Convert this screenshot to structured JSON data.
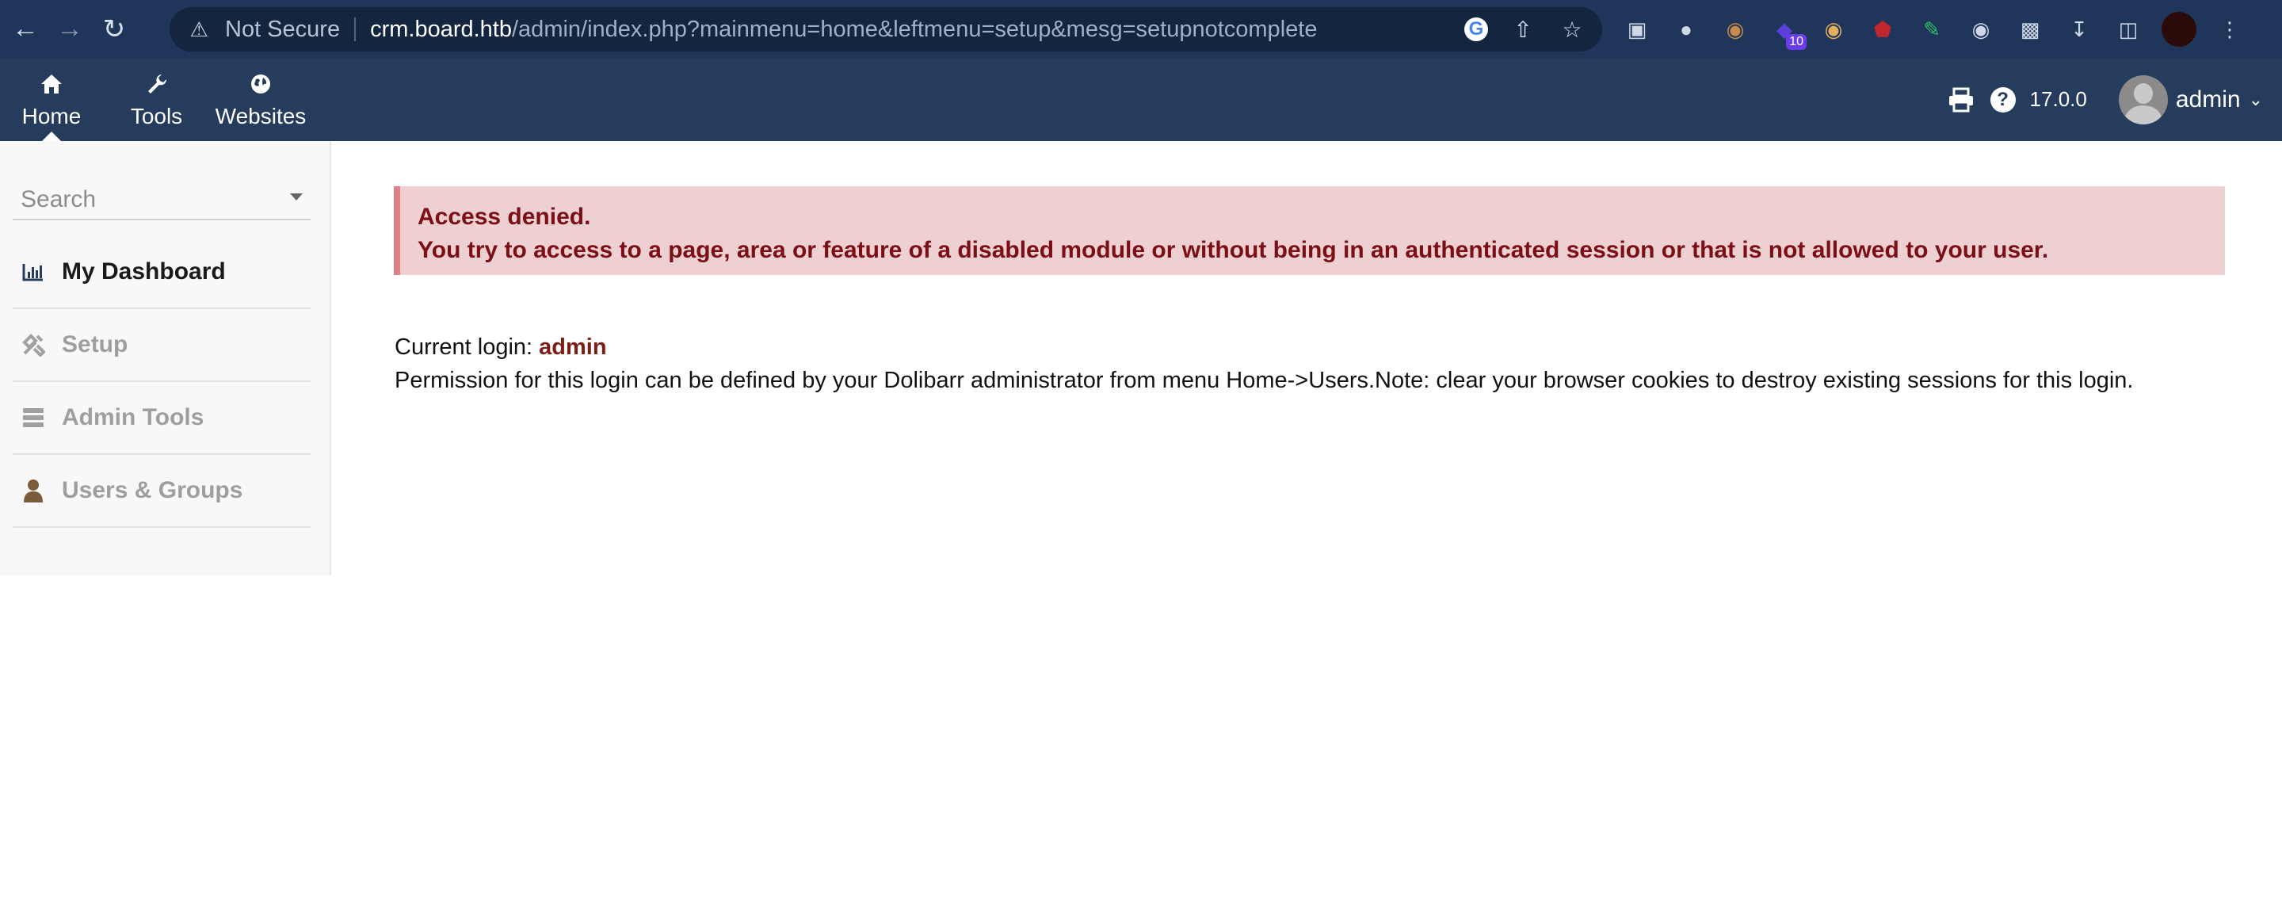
{
  "browser": {
    "security_label": "Not Secure",
    "url_host": "crm.board.htb",
    "url_path": "/admin/index.php?mainmenu=home&leftmenu=setup&mesg=setupnotcomplete",
    "extension_badge": "10"
  },
  "topmenu": {
    "items": [
      {
        "label": "Home",
        "icon": "home-icon"
      },
      {
        "label": "Tools",
        "icon": "wrench-icon"
      },
      {
        "label": "Websites",
        "icon": "globe-icon"
      }
    ],
    "version": "17.0.0",
    "user": "admin"
  },
  "sidebar": {
    "search_placeholder": "Search",
    "items": [
      {
        "label": "My Dashboard",
        "icon": "chart-icon"
      },
      {
        "label": "Setup",
        "icon": "tools-icon"
      },
      {
        "label": "Admin Tools",
        "icon": "server-icon"
      },
      {
        "label": "Users & Groups",
        "icon": "user-icon"
      }
    ]
  },
  "content": {
    "alert_title": "Access denied.",
    "alert_message": "You try to access to a page, area or feature of a disabled module or without being in an authenticated session or that is not allowed to your user.",
    "login_label": "Current login: ",
    "login_user": "admin",
    "permission_text": "Permission for this login can be defined by your Dolibarr administrator from menu Home->Users.Note: clear your browser cookies to destroy existing sessions for this login."
  },
  "colors": {
    "topbar": "#263c5c",
    "alert_bg": "#eecfd2",
    "alert_text": "#7a0f15"
  }
}
